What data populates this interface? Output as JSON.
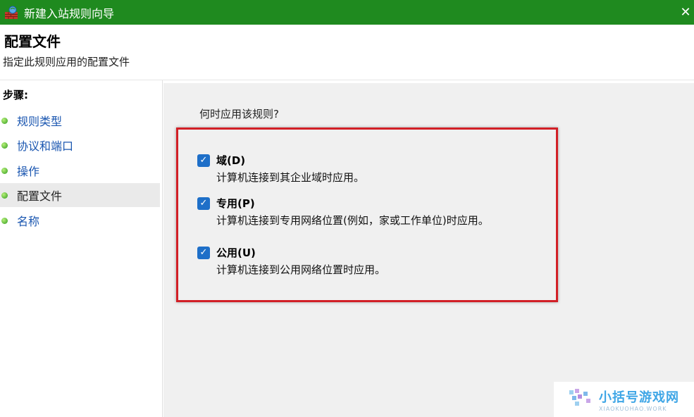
{
  "window": {
    "title": "新建入站规则向导",
    "close_symbol": "✕"
  },
  "header": {
    "title": "配置文件",
    "subtitle": "指定此规则应用的配置文件"
  },
  "sidebar": {
    "steps_label": "步骤:",
    "items": [
      {
        "label": "规则类型"
      },
      {
        "label": "协议和端口"
      },
      {
        "label": "操作"
      },
      {
        "label": "配置文件",
        "active": true
      },
      {
        "label": "名称"
      }
    ]
  },
  "content": {
    "question": "何时应用该规则?",
    "options": [
      {
        "title": "域(D)",
        "description": "计算机连接到其企业域时应用。",
        "checked": true
      },
      {
        "title": "专用(P)",
        "description": "计算机连接到专用网络位置(例如，家或工作单位)时应用。",
        "checked": true
      },
      {
        "title": "公用(U)",
        "description": "计算机连接到公用网络位置时应用。",
        "checked": true
      }
    ]
  },
  "watermark": {
    "main": "小括号游戏网",
    "sub": "XIAOKUOHAO.WORK"
  },
  "colors": {
    "titlebar": "#1f8a1f",
    "highlight": "#d21f26",
    "checkbox": "#1e6fc8",
    "link": "#1a56b0"
  }
}
